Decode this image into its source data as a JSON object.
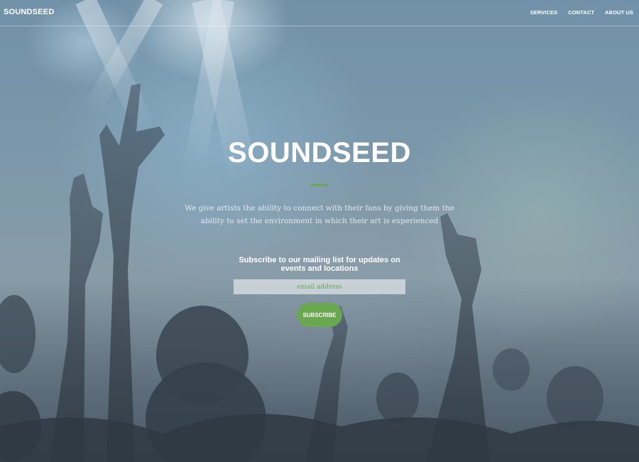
{
  "navbar": {
    "brand": "SOUNDSEED",
    "links": [
      "SERVICES",
      "CONTACT",
      "ABOUT US"
    ]
  },
  "hero": {
    "title": "SOUNDSEED",
    "tagline": "We give artists the ability to connect with their fans by giving them the ability to set the environment in which their art is experienced",
    "background": "concert-crowd-photo"
  },
  "subscribe": {
    "heading": "Subscribe to our mailing list for updates on events and locations",
    "email_placeholder": "email address",
    "button_label": "SUBSCRIBE"
  },
  "colors": {
    "accent": "#6aa84f",
    "text": "#ffffff"
  }
}
